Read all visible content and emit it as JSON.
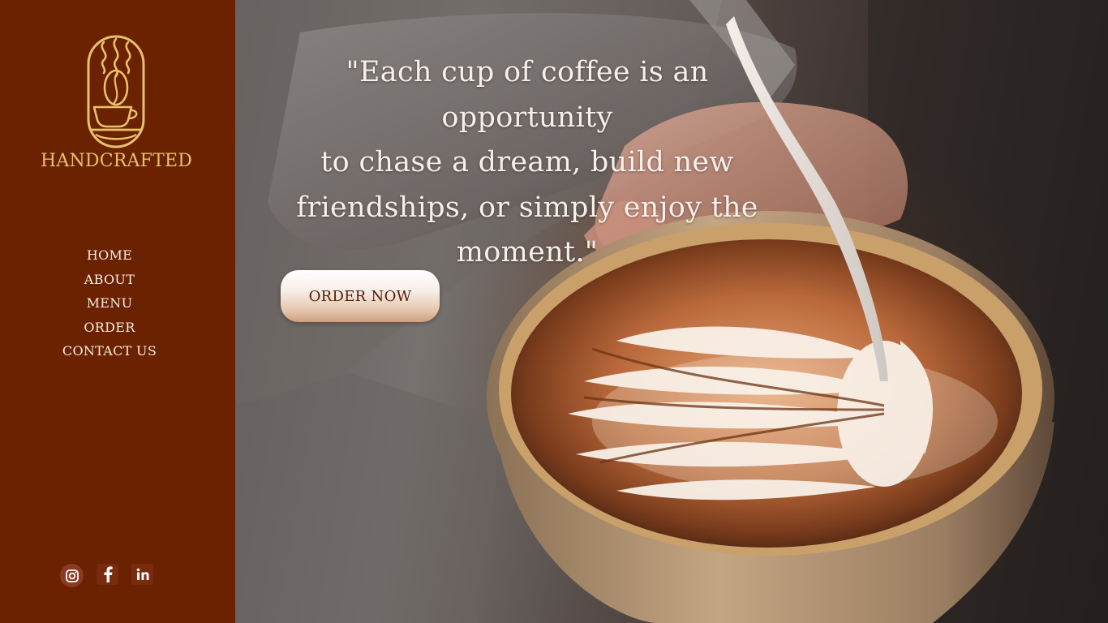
{
  "brand": {
    "name": "HANDCRAFTED",
    "logo_icon": "coffee-cup-logo-icon",
    "logo_color": "#e9c06c"
  },
  "nav": {
    "items": [
      {
        "label": "HOME"
      },
      {
        "label": "ABOUT"
      },
      {
        "label": "MENU"
      },
      {
        "label": "ORDER"
      },
      {
        "label": "CONTACT US"
      }
    ]
  },
  "socials": [
    {
      "name": "instagram",
      "icon": "instagram-icon"
    },
    {
      "name": "facebook",
      "icon": "facebook-icon"
    },
    {
      "name": "linkedin",
      "icon": "linkedin-icon"
    }
  ],
  "hero": {
    "quote_lines": [
      "\"Each cup of coffee is an opportunity",
      "to chase a dream, build new",
      "friendships, or simply enjoy the",
      "moment.\""
    ],
    "cta_label": "ORDER NOW",
    "image": "latte-art-pour-photo"
  },
  "colors": {
    "sidebar": "#6a2200",
    "accent_gold": "#e9c06c",
    "nav_text": "#f5ece4",
    "cta_text": "#5a1b05"
  }
}
